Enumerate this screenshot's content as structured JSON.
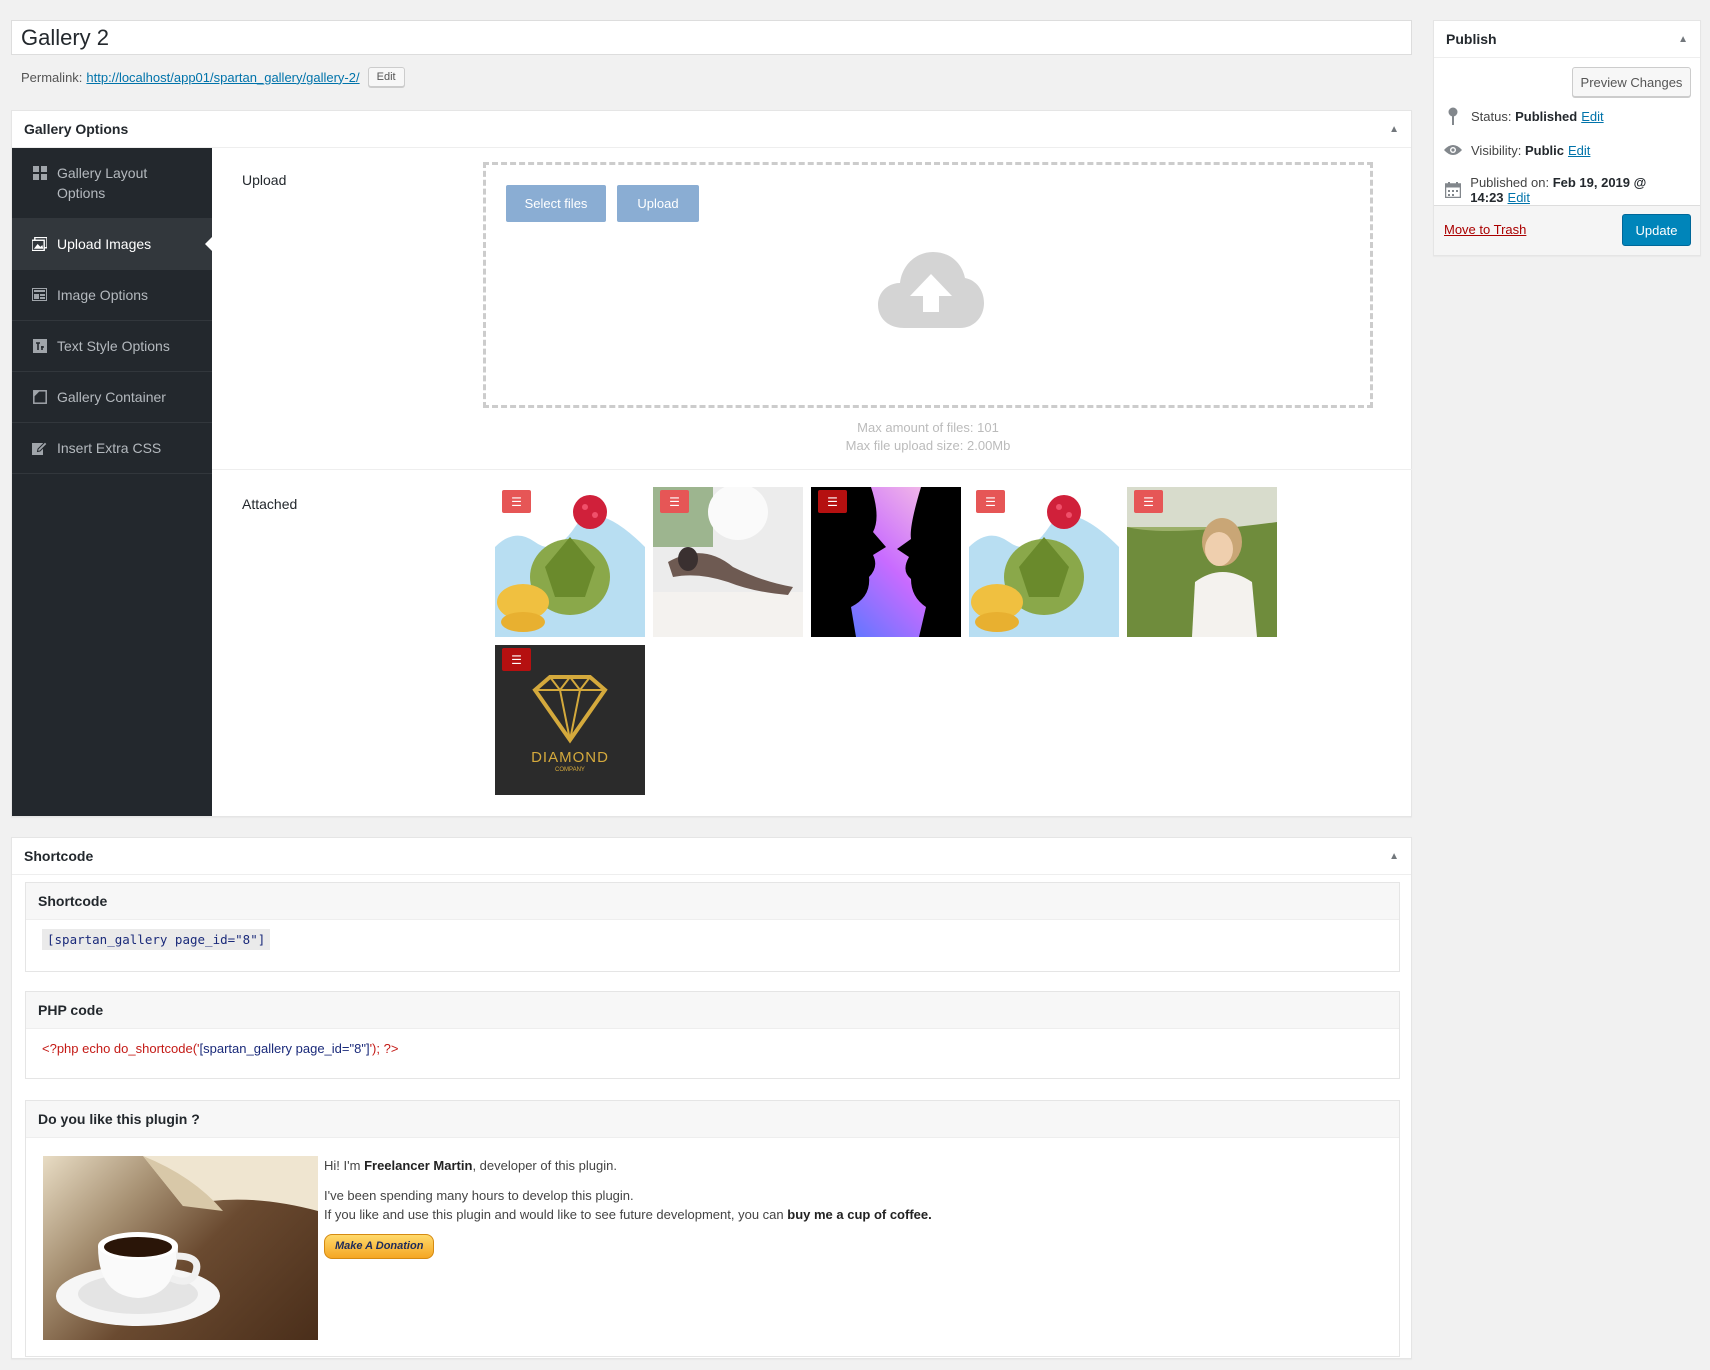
{
  "post": {
    "title": "Gallery 2",
    "permalink_label": "Permalink:",
    "permalink_prefix": "http://localhost/app01/spartan_gallery/",
    "permalink_slug": "gallery-2",
    "permalink_suffix": "/",
    "edit_label": "Edit"
  },
  "gallery_options": {
    "title": "Gallery Options",
    "nav": [
      {
        "label": "Gallery Layout Options",
        "icon": "grid-icon"
      },
      {
        "label": "Upload Images",
        "icon": "images-icon"
      },
      {
        "label": "Image Options",
        "icon": "layout-icon"
      },
      {
        "label": "Text Style Options",
        "icon": "text-style-icon"
      },
      {
        "label": "Gallery Container",
        "icon": "container-icon"
      },
      {
        "label": "Insert Extra CSS",
        "icon": "edit-icon"
      }
    ],
    "upload_label": "Upload",
    "select_files": "Select files",
    "upload_button": "Upload",
    "max_files": "Max amount of files: 101",
    "max_size": "Max file upload size: 2.00Mb",
    "attached_label": "Attached",
    "thumbnails": [
      {
        "name": "artichoke-raspberry",
        "badge": "light"
      },
      {
        "name": "tattoo-woman",
        "badge": "light"
      },
      {
        "name": "silhouette-gradient",
        "badge": "dark"
      },
      {
        "name": "artichoke-raspberry",
        "badge": "light"
      },
      {
        "name": "woman-field",
        "badge": "light"
      },
      {
        "name": "diamond-logo",
        "badge": "dark"
      }
    ],
    "diamond_text": "DIAMOND",
    "diamond_sub": "COMPANY"
  },
  "shortcode_box": {
    "title": "Shortcode",
    "shortcode_title": "Shortcode",
    "shortcode": "[spartan_gallery page_id=\"8\"]",
    "php_title": "PHP code",
    "php_open": "<?php echo do_shortcode('",
    "php_string": "[spartan_gallery page_id=\"8\"]",
    "php_close": "'); ?>",
    "like_title": "Do you like this plugin ?",
    "hi": "Hi! I'm",
    "dev_name": "Freelancer Martin",
    "hi_rest": ", developer of this plugin.",
    "spent": "I've been spending many hours to develop this plugin.",
    "if_like": "If you like and use this plugin and would like to see future development, you can",
    "coffee": "buy me a cup of coffee.",
    "donate": "Make A Donation"
  },
  "publish": {
    "title": "Publish",
    "preview": "Preview Changes",
    "status_label": "Status:",
    "status_value": "Published",
    "visibility_label": "Visibility:",
    "visibility_value": "Public",
    "published_label": "Published on:",
    "published_value": "Feb 19, 2019 @ 14:23",
    "edit": "Edit",
    "trash": "Move to Trash",
    "update": "Update"
  },
  "colors": {
    "sidebar_bg": "#23282d",
    "primary": "#0085ba",
    "link": "#0073aa",
    "dropzone_button": "#8aadd3",
    "badge": "#e65656"
  }
}
